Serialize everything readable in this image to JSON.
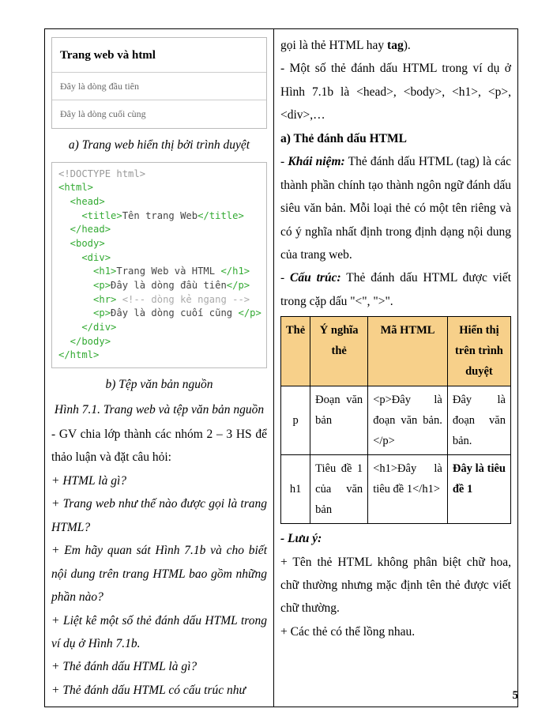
{
  "left": {
    "browser": {
      "title": "Trang web và html",
      "line1": "Đây là dòng đầu tiên",
      "line2": "Đây là dòng cuối cùng"
    },
    "captionA": "a) Trang web hiển thị bởi trình duyệt",
    "code": {
      "l1": "<!DOCTYPE html>",
      "l2": "<html>",
      "l3": "  <head>",
      "l4a": "    <title>",
      "l4b": "Tên trang Web",
      "l4c": "</title>",
      "l5": "  </head>",
      "l6": "  <body>",
      "l7": "    <div>",
      "l8a": "      <h1>",
      "l8b": "Trang Web và HTML ",
      "l8c": "</h1>",
      "l9a": "      <p>",
      "l9b": "Đây là dòng đầu tiên",
      "l9c": "</p>",
      "l10a": "      <hr> ",
      "l10b": "<!-- dòng kẻ ngang -->",
      "l11a": "      <p>",
      "l11b": "Đây là dòng cuối cũng ",
      "l11c": "</p>",
      "l12": "    </div>",
      "l13": "  </body>",
      "l14": "</html>"
    },
    "captionB": "b) Tệp văn bản nguồn",
    "captionMain": "Hình 7.1. Trang web và tệp văn bản nguồn",
    "p1": "- GV chia lớp thành các nhóm 2 – 3 HS để thảo luận và đặt câu hỏi:",
    "p2": "+ HTML là gì?",
    "p3": "+ Trang web như thế nào được gọi là trang HTML?",
    "p4": "+ Em hãy quan sát Hình 7.1b và cho biết nội dung trên trang HTML bao gồm những phần nào?",
    "p5": "+ Liệt kê một số thẻ đánh dấu HTML trong ví dụ ở Hình 7.1b.",
    "p6": "+ Thẻ đánh dấu HTML là gì?",
    "p7": "+ Thẻ đánh dấu HTML có cấu trúc như"
  },
  "right": {
    "p1a": "gọi là thẻ HTML hay ",
    "p1b": "tag",
    "p1c": ").",
    "p2": "- Một số thẻ đánh dấu HTML trong ví dụ ở Hình 7.1b là <head>, <body>, <h1>, <p>, <div>,…",
    "h1": "a) Thẻ đánh dấu HTML",
    "p3a": "- ",
    "p3b": "Khái niệm:",
    "p3c": " Thẻ đánh dấu HTML (tag) là các thành phần chính tạo thành ngôn ngữ đánh dấu siêu văn bản. Mỗi loại thẻ có một tên riêng và có ý nghĩa nhất định trong định dạng nội dung của trang web.",
    "p4a": "- ",
    "p4b": "Cấu trúc:",
    "p4c": " Thẻ đánh dấu HTML được viết trong cặp dấu \"<\", \">\".",
    "table": {
      "h": {
        "c1": "Thẻ",
        "c2": "Ý nghĩa thẻ",
        "c3": "Mã HTML",
        "c4": "Hiển thị trên trình duyệt"
      },
      "r1": {
        "c1": "p",
        "c2": "Đoạn văn bản",
        "c3": "<p>Đây là đoạn văn bản.</p>",
        "c4": "Đây là đoạn văn bản."
      },
      "r2": {
        "c1": "h1",
        "c2": "Tiêu đề 1 của văn bản",
        "c3": "<h1>Đây là tiêu đề 1</h1>",
        "c4a": "Đây là tiêu đề 1"
      }
    },
    "p5": "- Lưu ý:",
    "p6": "+ Tên thẻ HTML không phân biệt chữ hoa, chữ thường nhưng mặc định tên thẻ được viết chữ thường.",
    "p7": "+ Các thẻ có thể lồng nhau."
  },
  "pageNum": "5"
}
